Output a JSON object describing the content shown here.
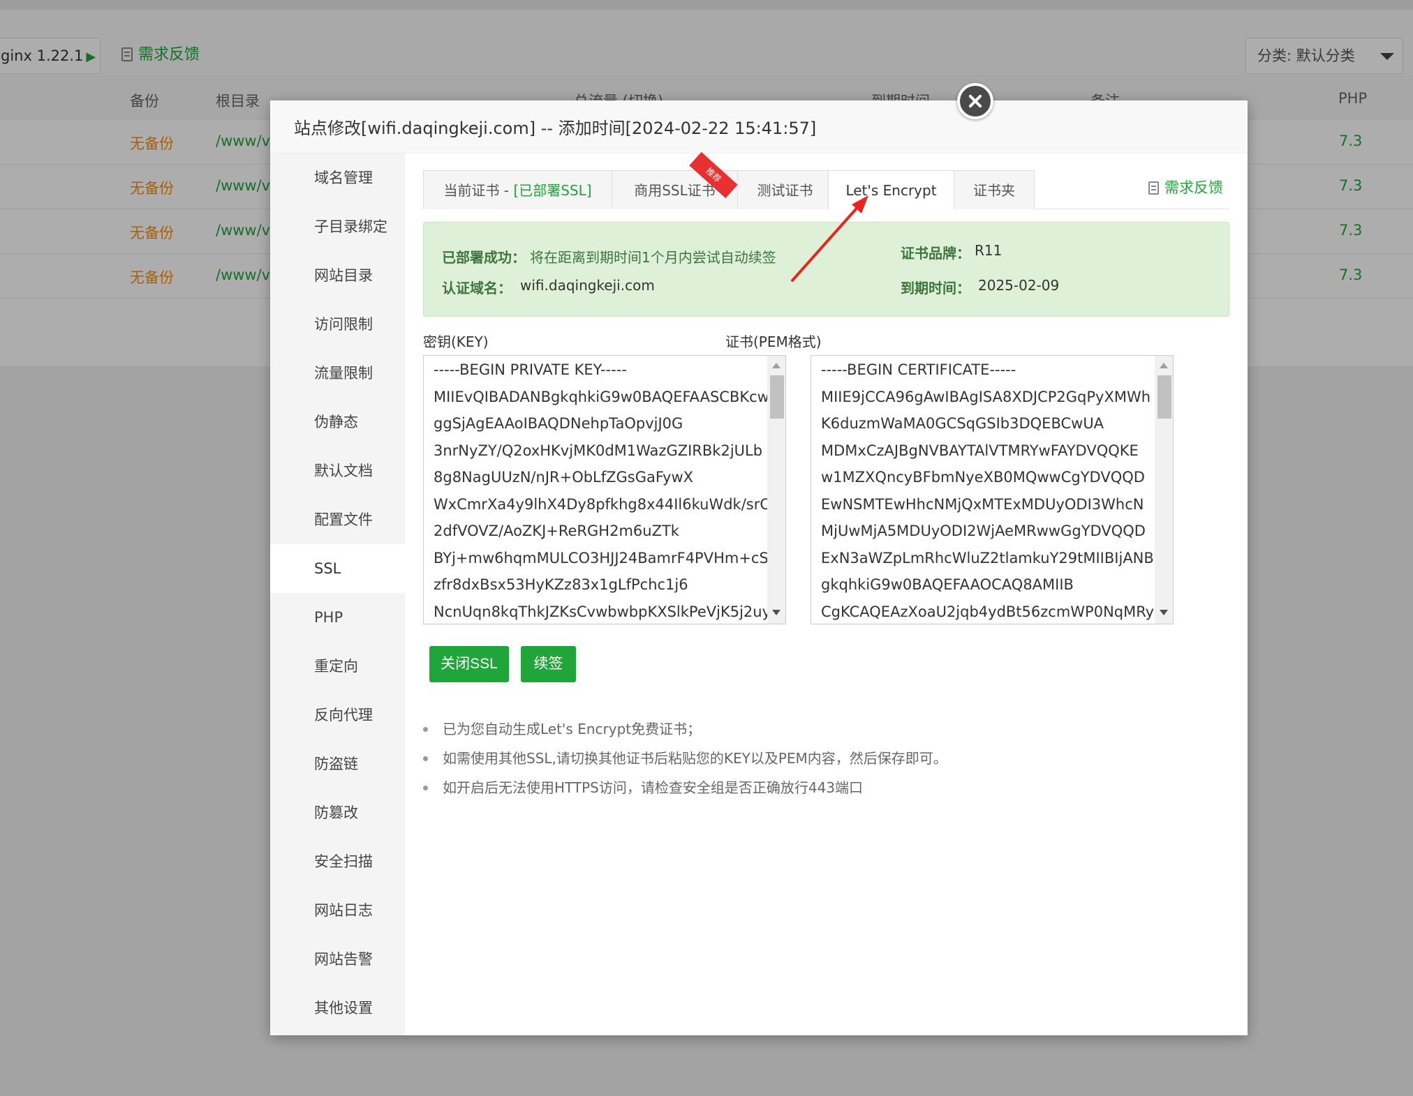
{
  "background": {
    "nginx_label": "ginx 1.22.1",
    "feedback_label": "需求反馈",
    "category_select": "分类: 默认分类",
    "columns": [
      "备份",
      "根目录",
      "总流量 (切换)",
      "到期时间",
      "备注",
      "PHP"
    ],
    "rows": [
      {
        "backup": "无备份",
        "root": "/www/v",
        "php": "7.3"
      },
      {
        "backup": "无备份",
        "root": "/www/v",
        "php": "7.3"
      },
      {
        "backup": "无备份",
        "root": "/www/v",
        "php": "7.3"
      },
      {
        "backup": "无备份",
        "root": "/www/v",
        "php": "7.3"
      }
    ]
  },
  "modal": {
    "title": "站点修改[wifi.daqingkeji.com] -- 添加时间[2024-02-22 15:41:57]",
    "menu": [
      "域名管理",
      "子目录绑定",
      "网站目录",
      "访问限制",
      "流量限制",
      "伪静态",
      "默认文档",
      "配置文件",
      "SSL",
      "PHP",
      "重定向",
      "反向代理",
      "防盗链",
      "防篡改",
      "安全扫描",
      "网站日志",
      "网站告警",
      "其他设置"
    ],
    "active_menu": "SSL",
    "tabs": {
      "current_prefix": "当前证书 - ",
      "current_status": "[已部署SSL]",
      "commercial": "商用SSL证书",
      "ribbon": "推荐",
      "test": "测试证书",
      "letsencrypt": "Let's Encrypt",
      "folder": "证书夹"
    },
    "feedback": "需求反馈",
    "status": {
      "deploy_label": "已部署成功：",
      "deploy_text": "将在距离到期时间1个月内尝试自动续签",
      "domain_label": "认证域名：",
      "domain_value": "wifi.daqingkeji.com",
      "brand_label": "证书品牌：",
      "brand_value": "R11",
      "expire_label": "到期时间：",
      "expire_value": "2025-02-09"
    },
    "key_label": "密钥(KEY)",
    "cert_label": "证书(PEM格式)",
    "key_lines": [
      "-----BEGIN PRIVATE KEY-----",
      "MIIEvQIBADANBgkqhkiG9w0BAQEFAASCBKcw",
      "ggSjAgEAAoIBAQDNehpTaOpvjJ0G",
      "3nrNyZY/Q2oxHKvjMK0dM1WazGZIRBk2jULb",
      "8g8NagUUzN/nJR+ObLfZGsGaFywX",
      "WxCmrXa4y9lhX4Dy8pfkhg8x44Il6kuWdk/srC",
      "2dfVOVZ/AoZKJ+ReRGH2m6uZTk",
      "BYj+mw6hqmMULCO3HJJ24BamrF4PVHm+cS",
      "zfr8dxBsx53HyKZz83x1gLfPchc1j6",
      "NcnUqn8kqThkJZKsCvwbwbpKXSlkPeVjK5j2uy"
    ],
    "cert_lines": [
      "-----BEGIN CERTIFICATE-----",
      "MIIE9jCCA96gAwIBAgISA8XDJCP2GqPyXMWh",
      "K6duzmWaMA0GCSqGSIb3DQEBCwUA",
      "MDMxCzAJBgNVBAYTAlVTMRYwFAYDVQQKE",
      "w1MZXQncyBFbmNyeXB0MQwwCgYDVQQD",
      "EwNSMTEwHhcNMjQxMTExMDUyODI3WhcN",
      "MjUwMjA5MDUyODI2WjAeMRwwGgYDVQQD",
      "ExN3aWZpLmRhcWluZ2tlamkuY29tMIIBIjANB",
      "gkqhkiG9w0BAQEFAAOCAQ8AMIIB",
      "CgKCAQEAzXoaU2jqb4ydBt56zcmWP0NqMRy"
    ],
    "buttons": {
      "close_ssl": "关闭SSL",
      "renew": "续签"
    },
    "tips": [
      "已为您自动生成Let's Encrypt免费证书；",
      "如需使用其他SSL,请切换其他证书后粘贴您的KEY以及PEM内容，然后保存即可。",
      "如开启后无法使用HTTPS访问，请检查安全组是否正确放行443端口"
    ]
  }
}
